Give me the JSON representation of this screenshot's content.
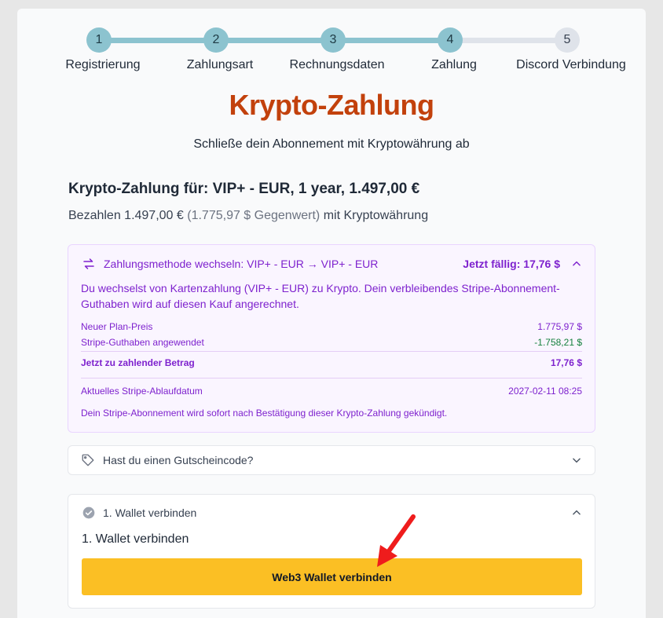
{
  "stepper": {
    "steps": [
      {
        "number": "1",
        "label": "Registrierung"
      },
      {
        "number": "2",
        "label": "Zahlungsart"
      },
      {
        "number": "3",
        "label": "Rechnungsdaten"
      },
      {
        "number": "4",
        "label": "Zahlung"
      },
      {
        "number": "5",
        "label": "Discord Verbindung"
      }
    ],
    "completed_through": 4
  },
  "header": {
    "title": "Krypto-Zahlung",
    "subtitle": "Schließe dein Abonnement mit Kryptowährung ab"
  },
  "order": {
    "title": "Krypto-Zahlung für: VIP+ - EUR, 1 year, 1.497,00 €",
    "pay_prefix": "Bezahlen 1.497,00 €",
    "pay_equivalent": "(1.775,97 $ Gegenwert)",
    "pay_suffix": "mit Kryptowährung"
  },
  "method_switch": {
    "icon": "swap-arrows-icon",
    "title": "Zahlungsmethode wechseln: VIP+ - EUR → VIP+ - EUR",
    "due_label": "Jetzt fällig: 17,76 $",
    "description": "Du wechselst von Kartenzahlung (VIP+ - EUR) zu Krypto. Dein verbleibendes Stripe-Abonnement-Guthaben wird auf diesen Kauf angerechnet.",
    "rows": [
      {
        "label": "Neuer Plan-Preis",
        "value": "1.775,97 $"
      },
      {
        "label": "Stripe-Guthaben angewendet",
        "value": "-1.758,21 $"
      }
    ],
    "total": {
      "label": "Jetzt zu zahlender Betrag",
      "value": "17,76 $"
    },
    "expiry": {
      "label": "Aktuelles Stripe-Ablaufdatum",
      "value": "2027-02-11 08:25"
    },
    "note": "Dein Stripe-Abonnement wird sofort nach Bestätigung dieser Krypto-Zahlung gekündigt."
  },
  "coupon": {
    "icon": "tag-icon",
    "label": "Hast du einen Gutscheincode?"
  },
  "wallet": {
    "icon": "check-circle-icon",
    "header_label": "1. Wallet verbinden",
    "subheading": "1. Wallet verbinden",
    "button_label": "Web3 Wallet verbinden"
  },
  "colors": {
    "accent": "#c2410c",
    "step_done": "#8cc3cf",
    "step_todo": "#dfe3ea",
    "purple": "#7e22ce",
    "button": "#fbbf24",
    "annotation_arrow": "#ef1c1c"
  }
}
